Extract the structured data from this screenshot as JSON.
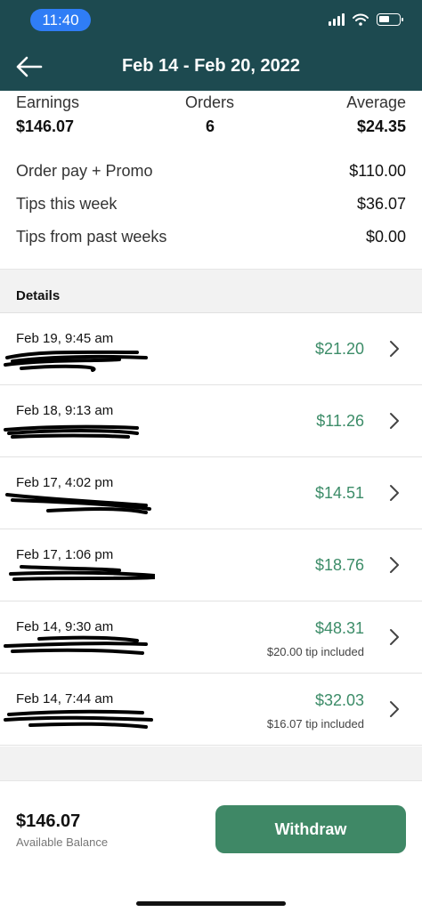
{
  "status_bar": {
    "time": "11:40"
  },
  "header": {
    "title": "Feb 14 - Feb 20, 2022",
    "back_icon": "arrow-left-icon"
  },
  "summary": {
    "earnings_label": "Earnings",
    "earnings_value": "$146.07",
    "orders_label": "Orders",
    "orders_value": "6",
    "average_label": "Average",
    "average_value": "$24.35",
    "lines": [
      {
        "label": "Order pay + Promo",
        "value": "$110.00"
      },
      {
        "label": "Tips this week",
        "value": "$36.07"
      },
      {
        "label": "Tips from past weeks",
        "value": "$0.00"
      }
    ]
  },
  "details": {
    "heading": "Details",
    "orders": [
      {
        "date": "Feb 19, 9:45 am",
        "amount": "$21.20",
        "tip_note": ""
      },
      {
        "date": "Feb 18, 9:13 am",
        "amount": "$11.26",
        "tip_note": ""
      },
      {
        "date": "Feb 17, 4:02 pm",
        "amount": "$14.51",
        "tip_note": ""
      },
      {
        "date": "Feb 17, 1:06 pm",
        "amount": "$18.76",
        "tip_note": ""
      },
      {
        "date": "Feb 14, 9:30 am",
        "amount": "$48.31",
        "tip_note": "$20.00 tip included"
      },
      {
        "date": "Feb 14, 7:44 am",
        "amount": "$32.03",
        "tip_note": "$16.07 tip included"
      }
    ]
  },
  "footer": {
    "balance": "$146.07",
    "balance_label": "Available Balance",
    "withdraw_label": "Withdraw"
  },
  "colors": {
    "header_bg": "#1d4a50",
    "accent_green": "#3f8866",
    "amount_green": "#3c8c68"
  }
}
